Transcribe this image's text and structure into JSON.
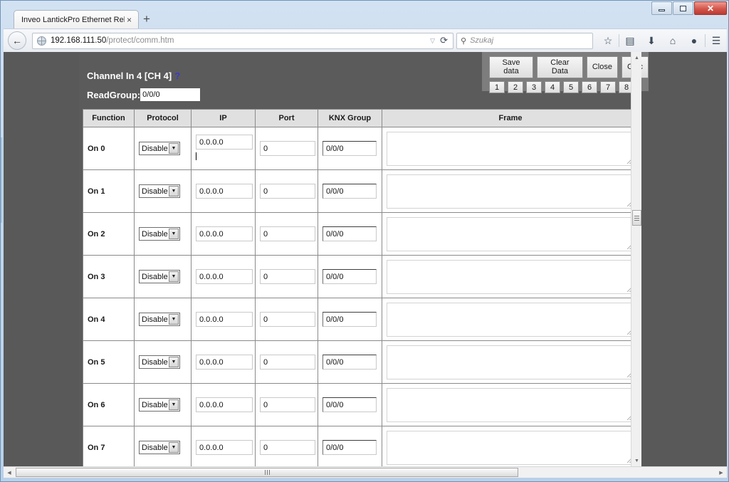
{
  "browser": {
    "tab": {
      "title": "Inveo LantickPro Ethernet Rela...",
      "close": "×"
    },
    "new_tab": "+",
    "window_controls": {
      "minimize": "minimize-icon",
      "restore": "restore-icon",
      "close": "✕"
    },
    "nav": {
      "back": "←",
      "url_host": "192.168.111.50",
      "url_path": "/protect/comm.htm",
      "url_caret": "▽",
      "reload": "⟳"
    },
    "search": {
      "placeholder": "Szukaj",
      "glyph": "⚲"
    },
    "toolbar_icons": [
      {
        "name": "bookmark-star-icon",
        "glyph": "☆"
      },
      {
        "name": "reading-list-icon",
        "glyph": "▤"
      },
      {
        "name": "downloads-icon",
        "glyph": "⬇"
      },
      {
        "name": "home-icon",
        "glyph": "⌂"
      },
      {
        "name": "sync-chat-icon",
        "glyph": "●"
      },
      {
        "name": "menu-hamburger-icon",
        "glyph": "☰"
      }
    ]
  },
  "page": {
    "heading": "Channel In 4 [CH 4]",
    "help_marker": "?",
    "readgroup_label": "ReadGroup:",
    "readgroup_value": "0/0/0",
    "buttons": {
      "save": "Save data",
      "clear": "Clear Data",
      "close": "Close",
      "calc": "Calc",
      "channels": [
        "1",
        "2",
        "3",
        "4",
        "5",
        "6",
        "7",
        "8"
      ]
    },
    "table": {
      "headers": [
        "Function",
        "Protocol",
        "IP",
        "Port",
        "KNX Group",
        "Frame"
      ],
      "rows": [
        {
          "function": "On 0",
          "protocol": "Disable",
          "ip": "0.0.0.0",
          "port": "0",
          "knx": "0/0/0",
          "frame": "",
          "focused": true
        },
        {
          "function": "On 1",
          "protocol": "Disable",
          "ip": "0.0.0.0",
          "port": "0",
          "knx": "0/0/0",
          "frame": "",
          "focused": false
        },
        {
          "function": "On 2",
          "protocol": "Disable",
          "ip": "0.0.0.0",
          "port": "0",
          "knx": "0/0/0",
          "frame": "",
          "focused": false
        },
        {
          "function": "On 3",
          "protocol": "Disable",
          "ip": "0.0.0.0",
          "port": "0",
          "knx": "0/0/0",
          "frame": "",
          "focused": false
        },
        {
          "function": "On 4",
          "protocol": "Disable",
          "ip": "0.0.0.0",
          "port": "0",
          "knx": "0/0/0",
          "frame": "",
          "focused": false
        },
        {
          "function": "On 5",
          "protocol": "Disable",
          "ip": "0.0.0.0",
          "port": "0",
          "knx": "0/0/0",
          "frame": "",
          "focused": false
        },
        {
          "function": "On 6",
          "protocol": "Disable",
          "ip": "0.0.0.0",
          "port": "0",
          "knx": "0/0/0",
          "frame": "",
          "focused": false
        },
        {
          "function": "On 7",
          "protocol": "Disable",
          "ip": "0.0.0.0",
          "port": "0",
          "knx": "0/0/0",
          "frame": "",
          "focused": false
        }
      ],
      "select_arrow": "▼"
    }
  },
  "scrollbars": {
    "v_up": "▲",
    "v_down": "▼",
    "h_left": "◀",
    "h_right": "▶"
  },
  "colors": {
    "page_bg": "#595959",
    "panel_bg": "#7d7d7d",
    "header_bg": "#e0e0e0",
    "link_blue": "#3a3ad0",
    "frame_blue": "#b9d0e8"
  }
}
